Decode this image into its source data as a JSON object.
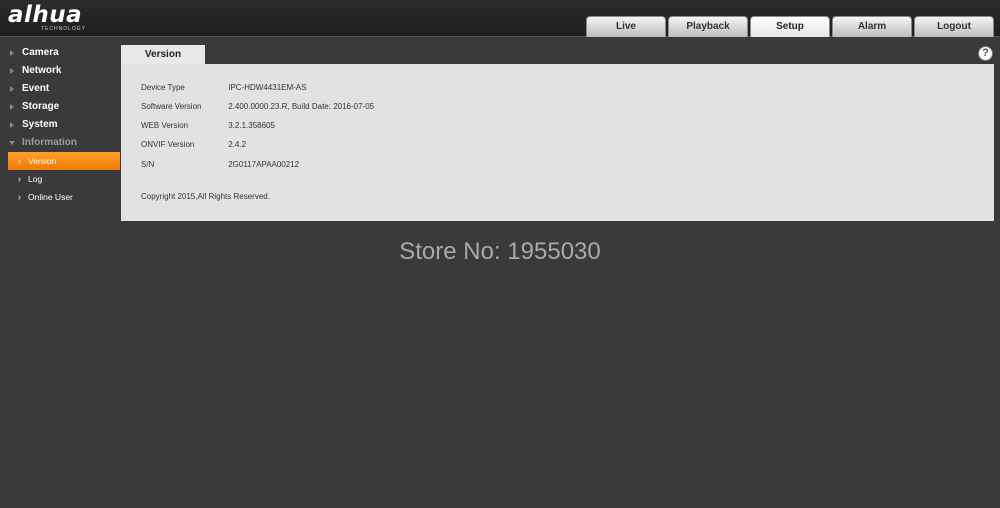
{
  "brand": {
    "logo": "alhua",
    "tagline": "TECHNOLOGY"
  },
  "nav": [
    "Live",
    "Playback",
    "Setup",
    "Alarm",
    "Logout"
  ],
  "nav_active": "Setup",
  "sidebar": {
    "sections": [
      "Camera",
      "Network",
      "Event",
      "Storage",
      "System",
      "Information"
    ],
    "sub_items": [
      "Version",
      "Log",
      "Online User"
    ]
  },
  "tab": "Version",
  "info": {
    "rows": [
      {
        "label": "Device Type",
        "value": "IPC-HDW4431EM-AS"
      },
      {
        "label": "Software Version",
        "value": "2.400.0000.23.R, Build Date: 2016-07-05"
      },
      {
        "label": "WEB Version",
        "value": "3.2.1.358605"
      },
      {
        "label": "ONVIF Version",
        "value": "2.4.2"
      },
      {
        "label": "S/N",
        "value": "2G0117APAA00212"
      }
    ],
    "copyright": "Copyright 2015,All Rights Reserved."
  },
  "help_icon": "help-circle-icon",
  "watermark": "Store No: 1955030",
  "colors": {
    "accent": "#f08a10",
    "background": "#3a3a3a",
    "panel": "#e2e2e2"
  }
}
